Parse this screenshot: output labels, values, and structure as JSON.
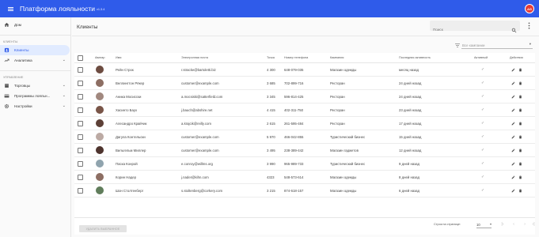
{
  "app": {
    "title": "Платформа лояльности",
    "version": "v1.3.4",
    "user_initials": "AG"
  },
  "sidebar": {
    "home": "Дом",
    "section_clients": "КЛИЕНТЫ",
    "clients": "Клиенты",
    "analytics": "Аналитика",
    "section_manage": "УПРАВЛЕНИЕ",
    "stores": "Торговцы",
    "programs": "Программы лояльн...",
    "settings": "Настройки"
  },
  "page": {
    "title": "Клиенты",
    "search_placeholder": "Поиск",
    "campaign_filter": "Все кампании"
  },
  "table": {
    "columns": {
      "avatar": "Аватар",
      "name": "Имя",
      "email": "Электронная почта",
      "points": "Точка",
      "phone": "Номер телефона",
      "campaign": "Кампания",
      "last_activity": "Последняя активность",
      "active": "Активный",
      "actions": "Действия"
    },
    "rows": [
      {
        "name": "Рейн Строк",
        "email": "r.stracke@bartoletti.biz",
        "points": "4 300",
        "phone": "648-079-035",
        "campaign": "Магазин одежды",
        "last": "месяц назад",
        "avatar_color": "#6d4c41"
      },
      {
        "name": "Веллингтон Рёкер",
        "email": "customer@example.com",
        "points": "3 685",
        "phone": "702-899-716",
        "campaign": "Ресторан",
        "last": "24 дней назад",
        "avatar_color": "#8d6e63"
      },
      {
        "name": "Аника Мосисски",
        "email": "a.mocsiski@satterfield.com",
        "points": "3 345",
        "phone": "596-814-425",
        "campaign": "Ресторан",
        "last": "24 дней назад",
        "avatar_color": "#a1887f"
      },
      {
        "name": "Хасинто Баух",
        "email": "j.bauch@abshire.net",
        "points": "4 415",
        "phone": "402-311-750",
        "campaign": "Ресторан",
        "last": "23 дней назад",
        "avatar_color": "#795548"
      },
      {
        "name": "Алесандро Крайчик",
        "email": "a.krajcik@reilly.com",
        "points": "2 615",
        "phone": "261-595-484",
        "campaign": "Ресторан",
        "last": "17 дней назад",
        "avatar_color": "#5d4037"
      },
      {
        "name": "Дагула Контельски",
        "email": "customer@example.com",
        "points": "5 970",
        "phone": "466-042-855",
        "campaign": "Туристический бизнес",
        "last": "15 дней назад",
        "avatar_color": "#bcaaa4"
      },
      {
        "name": "Вильгельм Миллер",
        "email": "customer@example.com",
        "points": "3 495",
        "phone": "238-389-442",
        "campaign": "Магазин гаджетов",
        "last": "12 дней назад",
        "avatar_color": "#4e342e"
      },
      {
        "name": "Паска Конрой",
        "email": "e.conroy@willms.org",
        "points": "3 990",
        "phone": "965-989-733",
        "campaign": "Туристический бизнес",
        "last": "9 дней назад",
        "avatar_color": "#90a4ae"
      },
      {
        "name": "Корин Надер",
        "email": "j.nader@kihn.com",
        "points": "4323",
        "phone": "548-573-614",
        "campaign": "Магазин одежды",
        "last": "8 дней назад",
        "avatar_color": "#8d6e63"
      },
      {
        "name": "Шон Столтенберг",
        "email": "s.stoltenberg@corkery.com",
        "points": "3 215",
        "phone": "874-618-157",
        "campaign": "Магазин одежды",
        "last": "6 дней назад",
        "avatar_color": "#607d5b"
      }
    ]
  },
  "delete_selected": "УДАЛИТЬ ВЫБРАННОЕ",
  "pagination": {
    "rows_per_page_label": "Строк на странице:",
    "rows_per_page": "10"
  }
}
